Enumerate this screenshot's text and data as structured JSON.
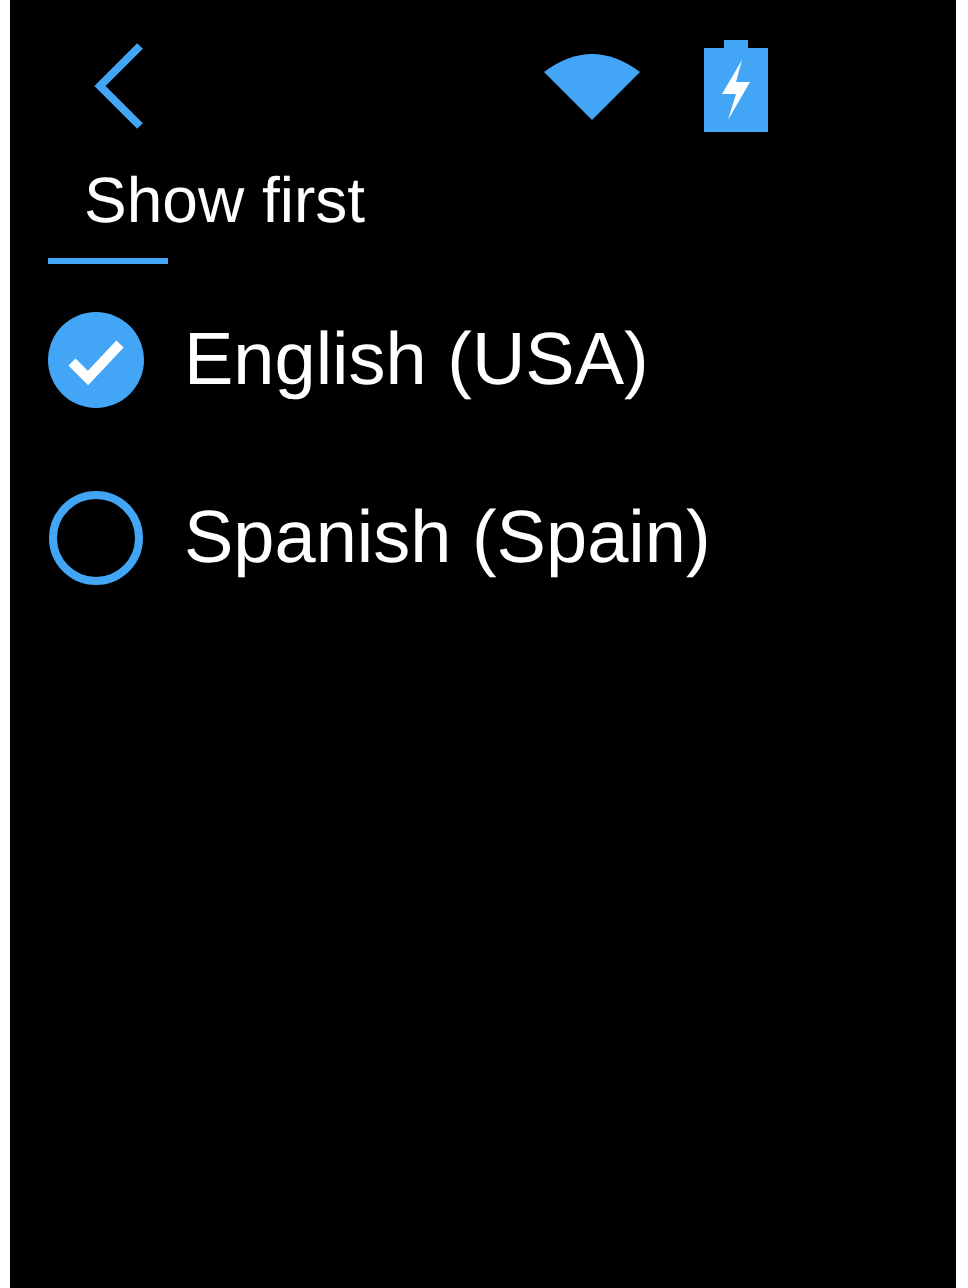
{
  "header": {
    "title": "Show first"
  },
  "options": [
    {
      "label": "English (USA)",
      "selected": true
    },
    {
      "label": "Spanish (Spain)",
      "selected": false
    }
  ]
}
